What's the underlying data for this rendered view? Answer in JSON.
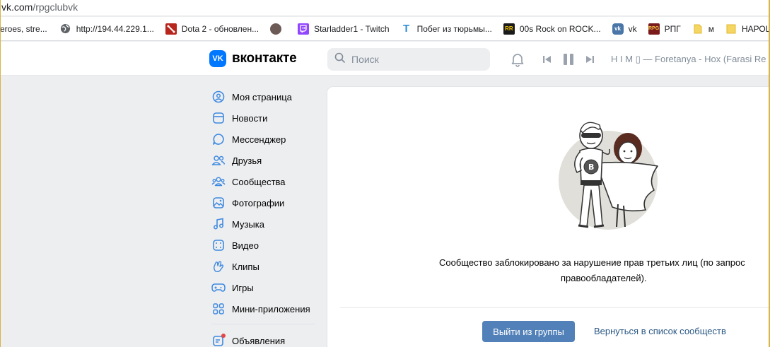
{
  "browser": {
    "url_host": "vk.com",
    "url_path": "/rpgclubvk",
    "bookmarks": [
      {
        "label": "eroes, stre...",
        "icon": "none"
      },
      {
        "label": "http://194.44.229.1...",
        "icon": "globe-icon"
      },
      {
        "label": "Dota 2 - обновлен...",
        "icon": "dota-icon"
      },
      {
        "label": "",
        "icon": "avatar-icon"
      },
      {
        "label": "Starladder1 - Twitch",
        "icon": "twitch-icon"
      },
      {
        "label": "Побег из тюрьмы...",
        "icon": "t-icon"
      },
      {
        "label": "00s Rock on ROCK...",
        "icon": "rr-icon"
      },
      {
        "label": "vk",
        "icon": "vk-icon"
      },
      {
        "label": "РПГ",
        "icon": "rpg-icon"
      },
      {
        "label": "м",
        "icon": "folder-icon"
      },
      {
        "label": "НАРОЩЕН",
        "icon": "folder-icon"
      }
    ]
  },
  "header": {
    "logo_text": "вконтакте",
    "logo_mark": "VK",
    "search_placeholder": "Поиск",
    "track": "H I M ▯ — Foretanya - Hox (Farasi Re"
  },
  "sidebar": {
    "items": [
      {
        "label": "Моя страница",
        "icon": "user-circle-icon"
      },
      {
        "label": "Новости",
        "icon": "news-icon"
      },
      {
        "label": "Мессенджер",
        "icon": "chat-icon"
      },
      {
        "label": "Друзья",
        "icon": "friends-icon"
      },
      {
        "label": "Сообщества",
        "icon": "communities-icon"
      },
      {
        "label": "Фотографии",
        "icon": "photos-icon"
      },
      {
        "label": "Музыка",
        "icon": "music-icon"
      },
      {
        "label": "Видео",
        "icon": "video-icon"
      },
      {
        "label": "Клипы",
        "icon": "clips-icon"
      },
      {
        "label": "Игры",
        "icon": "games-icon"
      },
      {
        "label": "Мини-приложения",
        "icon": "mini-apps-icon"
      }
    ],
    "ads_label": "Объявления"
  },
  "main": {
    "message_line1": "Сообщество заблокировано за нарушение прав третьих лиц (по запрос",
    "message_line2": "правообладателей).",
    "leave_button": "Выйти из группы",
    "back_link": "Вернуться в список сообществ"
  },
  "colors": {
    "vk_blue": "#0077ff",
    "button_blue": "#5181b8",
    "link_blue": "#2a5885",
    "icon_blue": "#3f8ae0",
    "frame": "#d9b44a"
  }
}
